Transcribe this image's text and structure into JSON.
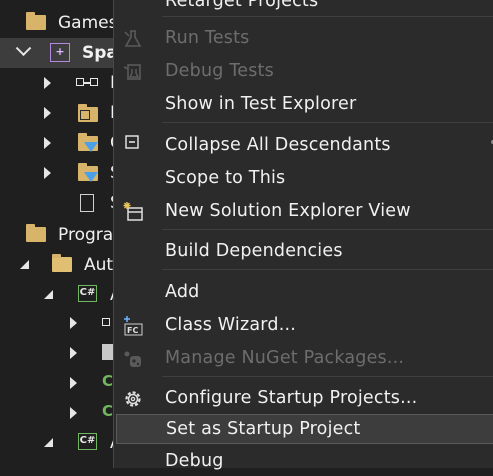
{
  "tree": {
    "rows": [
      {
        "label": "Games"
      },
      {
        "label": "Spa"
      },
      {
        "label": "I"
      },
      {
        "label": "I"
      },
      {
        "label": "C"
      },
      {
        "label": "S"
      },
      {
        "label": "S"
      },
      {
        "label": "Prograr"
      },
      {
        "label": "Auto"
      },
      {
        "label": "A"
      },
      {
        "label": ""
      },
      {
        "label": "S"
      },
      {
        "label": "C"
      },
      {
        "label": "C"
      },
      {
        "label": "A"
      }
    ]
  },
  "menu": {
    "items": [
      {
        "label": "Retarget Projects",
        "disabled": false
      },
      {
        "label": "Run Tests",
        "disabled": true
      },
      {
        "label": "Debug Tests",
        "disabled": true
      },
      {
        "label": "Show in Test Explorer",
        "disabled": false
      },
      {
        "label": "Collapse All Descendants",
        "disabled": false
      },
      {
        "label": "Scope to This",
        "disabled": false
      },
      {
        "label": "New Solution Explorer View",
        "disabled": false
      },
      {
        "label": "Build Dependencies",
        "disabled": false
      },
      {
        "label": "Add",
        "disabled": false
      },
      {
        "label": "Class Wizard...",
        "disabled": false
      },
      {
        "label": "Manage NuGet Packages...",
        "disabled": true
      },
      {
        "label": "Configure Startup Projects...",
        "disabled": false
      },
      {
        "label": "Set as Startup Project",
        "disabled": false,
        "highlighted": true
      },
      {
        "label": "Debug",
        "disabled": false
      }
    ]
  },
  "colors": {
    "background": "#1f1f1f",
    "menu_bg": "#2b2b2b",
    "text": "#f1f1f1",
    "disabled_text": "#6d6d6d",
    "folder": "#d7b46a",
    "csharp": "#72b65f",
    "filter": "#4ba0e8"
  }
}
